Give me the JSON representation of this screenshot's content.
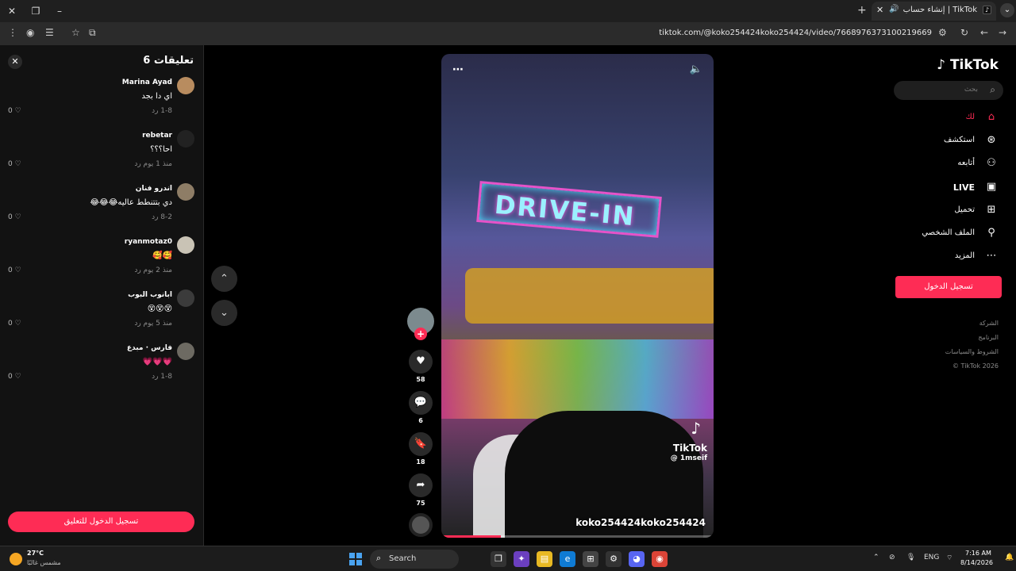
{
  "browser": {
    "tab_title": "إنشاء حساب | TikTok",
    "tab_favicon": "tiktok-icon",
    "url": "tiktok.com/@koko254424koko254424/video/7668976373100219669"
  },
  "comments": {
    "title": "تعليقات 6",
    "items": [
      {
        "user": "Marina Ayad",
        "text": "اي دا بجد",
        "meta": "1-8   رد",
        "likes": "0"
      },
      {
        "user": "rebetar",
        "text": "احا؟؟؟",
        "meta": "منذ 1 يوم   رد",
        "likes": "0"
      },
      {
        "user": "اندرو فنان",
        "text": "دي بتتنطط عاليه😂😂😂",
        "meta": "8-2   رد",
        "likes": "0"
      },
      {
        "user": "ryanmotaz0",
        "text": "🥰🥰",
        "meta": "منذ 2 يوم   رد",
        "likes": "0"
      },
      {
        "user": "ابانوب البوب",
        "text": "😵😵😵",
        "meta": "منذ 5 يوم   رد",
        "likes": "0"
      },
      {
        "user": "فارس · مبدع",
        "text": "💗💗💗",
        "meta": "1-8   رد",
        "likes": "0"
      }
    ],
    "login_label": "تسجيل الدخول للتعليق"
  },
  "video": {
    "sign_text": "DRIVE-IN",
    "watermark_brand": "TikTok",
    "watermark_user": "@ 1mseif",
    "author": "koko254424koko254424",
    "progress": 0.22
  },
  "actions": {
    "likes": "58",
    "comments": "6",
    "saves": "18",
    "shares": "75"
  },
  "sidebar": {
    "logo": "TikTok",
    "search_placeholder": "بحث",
    "nav": [
      {
        "label": "لك",
        "icon": "home-icon",
        "active": true
      },
      {
        "label": "استكشف",
        "icon": "compass-icon"
      },
      {
        "label": "أتابعه",
        "icon": "following-icon"
      },
      {
        "label": "LIVE",
        "icon": "live-icon"
      },
      {
        "label": "تحميل",
        "icon": "upload-icon"
      },
      {
        "label": "الملف الشخصي",
        "icon": "profile-icon"
      },
      {
        "label": "المزيد",
        "icon": "more-icon"
      }
    ],
    "login_label": "تسجيل الدخول",
    "footer": [
      "الشركة",
      "البرنامج",
      "الشروط والسياسات",
      "TikTok 2026 ©"
    ]
  },
  "taskbar": {
    "temperature": "27°C",
    "weather_desc": "مشمس غالبًا",
    "search_label": "Search",
    "lang": "ENG",
    "time": "7:16 AM",
    "date": "8/14/2026"
  },
  "colors": {
    "accent": "#fe2c55"
  }
}
